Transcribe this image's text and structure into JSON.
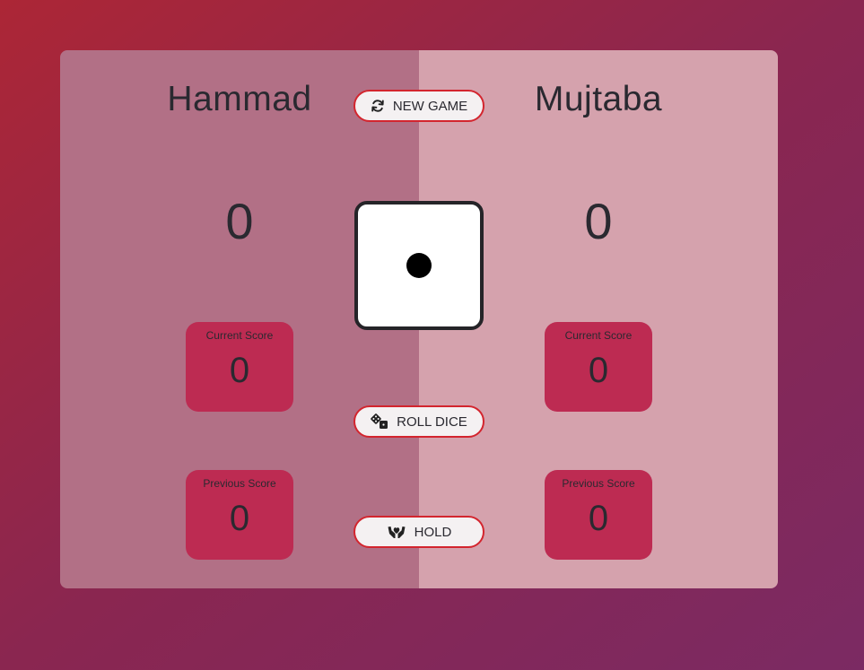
{
  "players": [
    {
      "name": "Hammad",
      "total_score": "0",
      "current": {
        "label": "Current Score",
        "value": "0"
      },
      "previous": {
        "label": "Previous Score",
        "value": "0"
      }
    },
    {
      "name": "Mujtaba",
      "total_score": "0",
      "current": {
        "label": "Current Score",
        "value": "0"
      },
      "previous": {
        "label": "Previous Score",
        "value": "0"
      }
    }
  ],
  "buttons": {
    "new_game": {
      "label": "NEW GAME",
      "icon": "refresh-icon"
    },
    "roll_dice": {
      "label": "ROLL DICE",
      "icon": "dice-icon"
    },
    "hold": {
      "label": "HOLD",
      "icon": "hold-hands-icon"
    }
  },
  "dice": {
    "face_value": 1
  },
  "colors": {
    "player_0_panel": "#b27086",
    "player_1_panel": "#d5a2ad",
    "score_box": "#bd2b52",
    "button_border": "#d3252e",
    "text": "#2a2930"
  }
}
